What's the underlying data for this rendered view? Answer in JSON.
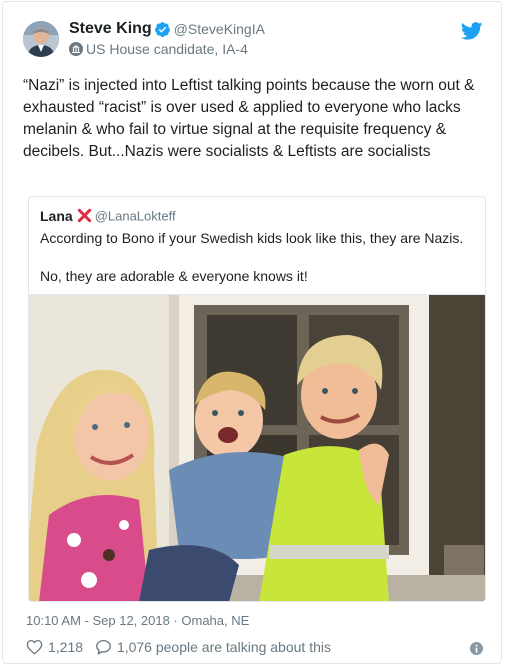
{
  "author": {
    "name": "Steve King",
    "handle": "@SteveKingIA",
    "label": "US House candidate, IA-4",
    "verified_color": "#1da1f2"
  },
  "tweet": {
    "text": "“Nazi” is injected into Leftist talking points because the worn out & exhausted “racist” is over used & applied to everyone who lacks melanin & who fail to virtue signal at the requisite frequency & decibels. But...Nazis were socialists & Leftists are socialists"
  },
  "quoted": {
    "name": "Lana",
    "name_emoji": "cross-mark-icon",
    "handle": "@LanaLokteff",
    "text": "According to Bono if your Swedish kids look like this, they are Nazis.\n\nNo, they are adorable & everyone knows it!"
  },
  "meta": {
    "timestamp": "10:10 AM - Sep 12, 2018 · Omaha, NE"
  },
  "actions": {
    "likes": "1,218",
    "talking": "1,076 people are talking about this"
  },
  "colors": {
    "brand_blue": "#1da1f2",
    "muted_text": "#697882",
    "border": "#e1e8ed",
    "x_red": "#dd2e44"
  }
}
